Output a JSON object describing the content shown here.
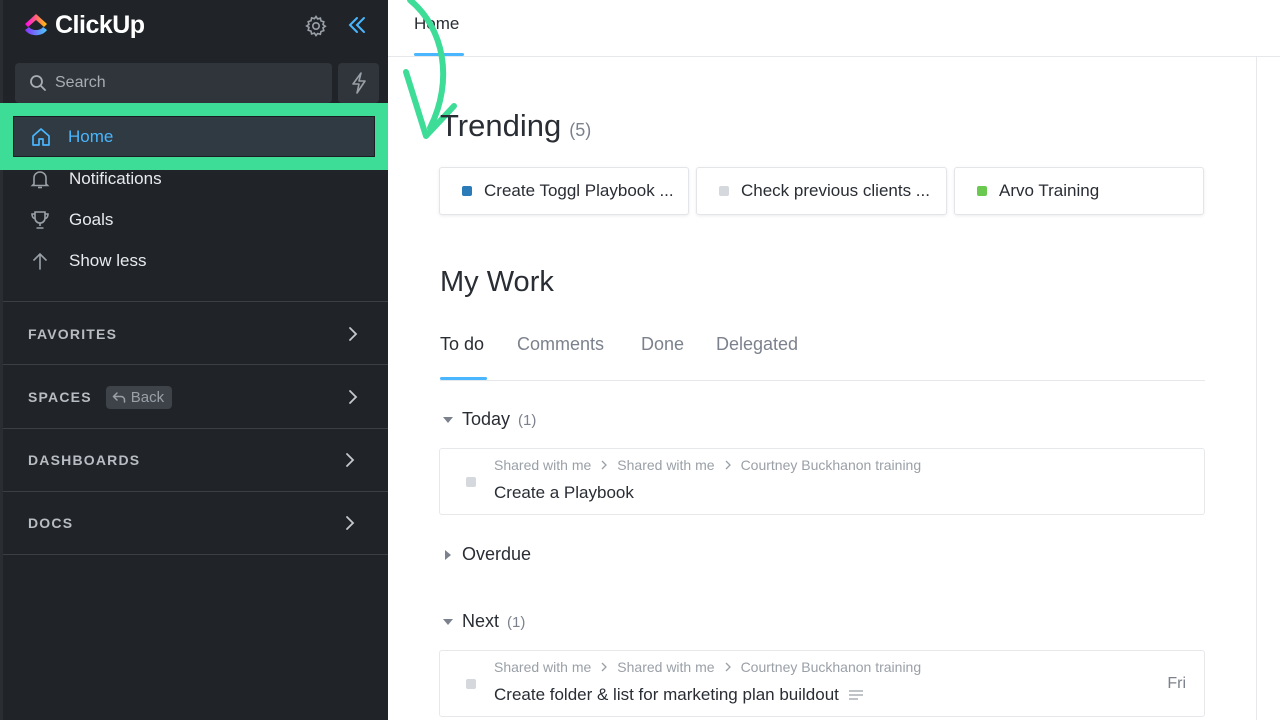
{
  "app": {
    "name": "ClickUp"
  },
  "sidebar": {
    "search_placeholder": "Search",
    "nav": [
      {
        "label": "Home",
        "icon": "home-icon",
        "active": true
      },
      {
        "label": "Notifications",
        "icon": "bell-icon"
      },
      {
        "label": "Goals",
        "icon": "trophy-icon"
      },
      {
        "label": "Show less",
        "icon": "arrow-up-icon"
      }
    ],
    "sections": [
      {
        "label": "FAVORITES"
      },
      {
        "label": "SPACES",
        "badge": "Back"
      },
      {
        "label": "DASHBOARDS"
      },
      {
        "label": "DOCS"
      }
    ]
  },
  "topbar": {
    "tab": "Home"
  },
  "trending": {
    "title": "Trending",
    "count": "(5)",
    "cards": [
      {
        "label": "Create Toggl Playbook ...",
        "color": "#2b7bb9"
      },
      {
        "label": "Check previous clients ...",
        "color": "#d5d8dc"
      },
      {
        "label": "Arvo Training",
        "color": "#6bc950"
      }
    ]
  },
  "mywork": {
    "title": "My Work",
    "tabs": [
      "To do",
      "Comments",
      "Done",
      "Delegated"
    ],
    "groups": [
      {
        "label": "Today",
        "count": "(1)"
      },
      {
        "label": "Overdue",
        "count": ""
      },
      {
        "label": "Next",
        "count": "(1)"
      }
    ],
    "tasks": [
      {
        "crumbs": [
          "Shared with me",
          "Shared with me",
          "Courtney Buckhanon training"
        ],
        "name": "Create a Playbook",
        "due": ""
      },
      {
        "crumbs": [
          "Shared with me",
          "Shared with me",
          "Courtney Buckhanon training"
        ],
        "name": "Create folder & list for marketing plan buildout",
        "due": "Fri"
      }
    ]
  },
  "colors": {
    "accent": "#49b6ff",
    "highlight": "#3ddc97",
    "sidebar_bg": "#202428"
  }
}
